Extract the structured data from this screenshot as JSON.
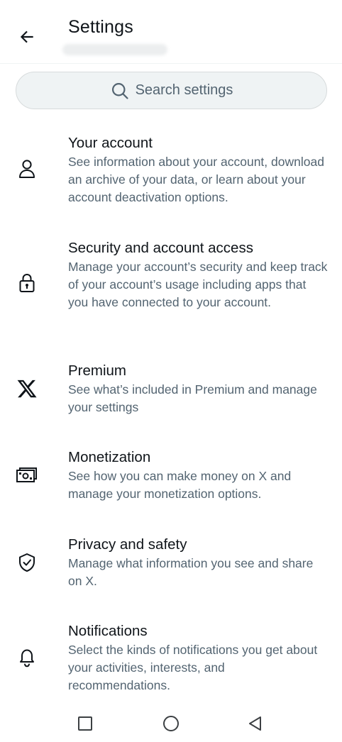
{
  "header": {
    "title": "Settings",
    "back_icon": "arrow-left-icon"
  },
  "search": {
    "placeholder": "Search settings",
    "icon": "search-icon"
  },
  "items": [
    {
      "icon": "person-icon",
      "title": "Your account",
      "description": "See information about your account, download an archive of your data, or learn about your account deactivation options."
    },
    {
      "icon": "lock-icon",
      "title": "Security and account access",
      "description": "Manage your account’s security and keep track of your account’s usage including apps that you have connected to your account."
    },
    {
      "icon": "x-logo-icon",
      "title": "Premium",
      "description": "See what’s included in Premium and manage your settings"
    },
    {
      "icon": "money-icon",
      "title": "Monetization",
      "description": "See how you can make money on X and manage your monetization options."
    },
    {
      "icon": "shield-check-icon",
      "title": "Privacy and safety",
      "description": "Manage what information you see and share on X."
    },
    {
      "icon": "bell-icon",
      "title": "Notifications",
      "description": "Select the kinds of notifications you get about your activities, interests, and recommendations."
    }
  ],
  "navbar": {
    "recents_icon": "square-icon",
    "home_icon": "circle-icon",
    "back_icon": "triangle-back-icon"
  },
  "colors": {
    "text_primary": "#0f1419",
    "text_secondary": "#536471",
    "search_bg": "#eff3f4"
  }
}
